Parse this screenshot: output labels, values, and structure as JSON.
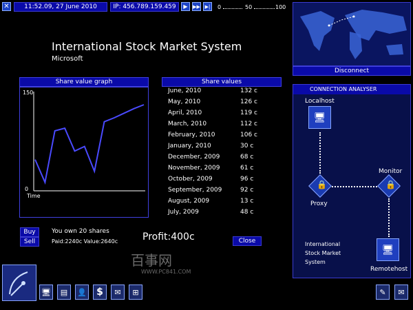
{
  "topbar": {
    "datetime": "11:52.09, 27 June 2010",
    "ip": "IP: 456.789.159.459",
    "scale": [
      "0",
      "50",
      "100"
    ]
  },
  "header": {
    "title": "International Stock Market System",
    "company": "Microsoft"
  },
  "graph_panel": {
    "title": "Share value graph",
    "y_top": "150",
    "y_zero": "0",
    "x_label": "Time"
  },
  "table": {
    "title": "Share values",
    "rows": [
      {
        "month": "June, 2010",
        "value": "132 c"
      },
      {
        "month": "May, 2010",
        "value": "126 c"
      },
      {
        "month": "April, 2010",
        "value": "119 c"
      },
      {
        "month": "March, 2010",
        "value": "112 c"
      },
      {
        "month": "February, 2010",
        "value": "106 c"
      },
      {
        "month": "January, 2010",
        "value": "30 c"
      },
      {
        "month": "December, 2009",
        "value": "68 c"
      },
      {
        "month": "November, 2009",
        "value": "61 c"
      },
      {
        "month": "October, 2009",
        "value": "96 c"
      },
      {
        "month": "September, 2009",
        "value": "92 c"
      },
      {
        "month": "August, 2009",
        "value": "13 c"
      },
      {
        "month": "July, 2009",
        "value": "48 c"
      }
    ]
  },
  "actions": {
    "buy": "Buy",
    "sell": "Sell",
    "own": "You own 20 shares",
    "paid": "Paid:2240c Value:2640c",
    "profit": "Profit:400c",
    "close": "Close"
  },
  "map": {
    "disconnect": "Disconnect"
  },
  "connection": {
    "title": "CONNECTION ANALYSER",
    "localhost": "Localhost",
    "monitor": "Monitor",
    "proxy": "Proxy",
    "remote_label": "International\nStock Market\nSystem",
    "remotehost": "Remotehost"
  },
  "watermark": {
    "text": "百事网",
    "url": "WWW.PC841.COM"
  },
  "chart_data": {
    "type": "line",
    "y_range": [
      0,
      150
    ],
    "values": [
      48,
      13,
      92,
      96,
      61,
      68,
      30,
      106,
      112,
      119,
      126,
      132
    ]
  },
  "colors": {
    "accent": "#0a0aa8",
    "line": "#4a4aff"
  }
}
